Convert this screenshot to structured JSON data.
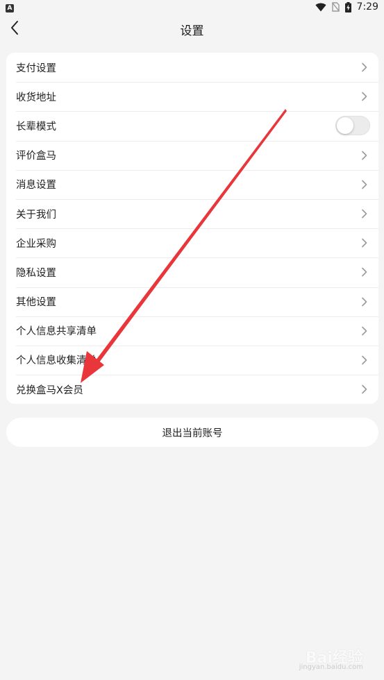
{
  "status_bar": {
    "app_badge": "A",
    "time": "7:29",
    "icons": [
      "wifi-icon",
      "no-sim-icon",
      "battery-charging-icon"
    ]
  },
  "header": {
    "title": "设置",
    "back_icon": "chevron-left-icon"
  },
  "settings": {
    "items": [
      {
        "label": "支付设置",
        "control": "chevron"
      },
      {
        "label": "收货地址",
        "control": "chevron"
      },
      {
        "label": "长辈模式",
        "control": "toggle",
        "toggle_on": false
      },
      {
        "label": "评价盒马",
        "control": "chevron"
      },
      {
        "label": "消息设置",
        "control": "chevron"
      },
      {
        "label": "关于我们",
        "control": "chevron"
      },
      {
        "label": "企业采购",
        "control": "chevron"
      },
      {
        "label": "隐私设置",
        "control": "chevron"
      },
      {
        "label": "其他设置",
        "control": "chevron"
      },
      {
        "label": "个人信息共享清单",
        "control": "chevron"
      },
      {
        "label": "个人信息收集清单",
        "control": "chevron"
      },
      {
        "label": "兑换盒马X会员",
        "control": "chevron"
      }
    ]
  },
  "logout": {
    "label": "退出当前账号"
  },
  "annotation": {
    "type": "arrow",
    "color": "#e8363a"
  },
  "watermark": {
    "text": "Bai经验",
    "sub": "jingyan.baidu.com"
  },
  "colors": {
    "background": "#f4f4f4",
    "card": "#ffffff",
    "divider": "#ececec",
    "text": "#1f1f1f",
    "chevron": "#9a9a9a",
    "toggle_off": "#ececec"
  }
}
